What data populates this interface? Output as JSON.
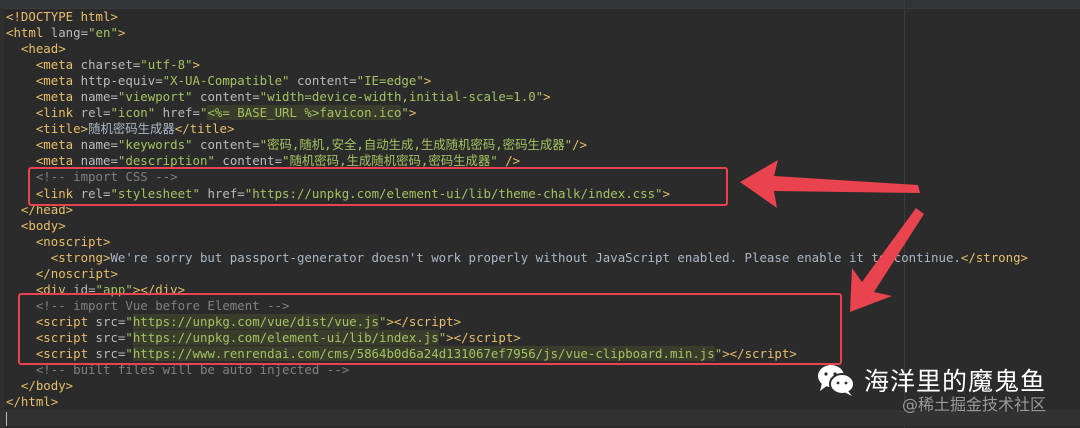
{
  "editor": {
    "lines": [
      [
        [
          "tag",
          "<!DOCTYPE html>"
        ]
      ],
      [
        [
          "tag",
          "<html "
        ],
        [
          "attr",
          "lang="
        ],
        [
          "val",
          "\"en\""
        ],
        [
          "tag",
          ">"
        ]
      ],
      [
        [
          "txt",
          "  "
        ],
        [
          "tag",
          "<head>"
        ]
      ],
      [
        [
          "txt",
          "    "
        ],
        [
          "tag",
          "<meta "
        ],
        [
          "attr",
          "charset="
        ],
        [
          "val",
          "\"utf-8\""
        ],
        [
          "tag",
          ">"
        ]
      ],
      [
        [
          "txt",
          "    "
        ],
        [
          "tag",
          "<meta "
        ],
        [
          "attr",
          "http-equiv="
        ],
        [
          "val",
          "\"X-UA-Compatible\""
        ],
        [
          "attr",
          " content="
        ],
        [
          "val",
          "\"IE=edge\""
        ],
        [
          "tag",
          ">"
        ]
      ],
      [
        [
          "txt",
          "    "
        ],
        [
          "tag",
          "<meta "
        ],
        [
          "attr",
          "name="
        ],
        [
          "val",
          "\"viewport\""
        ],
        [
          "attr",
          " content="
        ],
        [
          "val",
          "\"width=device-width,initial-scale=1.0\""
        ],
        [
          "tag",
          ">"
        ]
      ],
      [
        [
          "txt",
          "    "
        ],
        [
          "tag",
          "<link "
        ],
        [
          "attr",
          "rel="
        ],
        [
          "val",
          "\"icon\""
        ],
        [
          "attr",
          " href="
        ],
        [
          "val",
          "\""
        ],
        [
          "hl",
          "<%= BASE_URL %>favicon.ico"
        ],
        [
          "val",
          "\""
        ],
        [
          "tag",
          ">"
        ]
      ],
      [
        [
          "txt",
          "    "
        ],
        [
          "tag",
          "<title>"
        ],
        [
          "txt",
          "随机密码生成器"
        ],
        [
          "tag",
          "</title>"
        ]
      ],
      [
        [
          "txt",
          "    "
        ],
        [
          "tag",
          "<meta "
        ],
        [
          "attr",
          "name="
        ],
        [
          "val",
          "\"keywords\""
        ],
        [
          "attr",
          " content="
        ],
        [
          "val",
          "\"密码,随机,安全,自动生成,生成随机密码,密码生成器\""
        ],
        [
          "tag",
          "/>"
        ]
      ],
      [
        [
          "txt",
          "    "
        ],
        [
          "tag",
          "<meta "
        ],
        [
          "attr",
          "name="
        ],
        [
          "val",
          "\"description\""
        ],
        [
          "attr",
          " content="
        ],
        [
          "val",
          "\"随机密码,生成随机密码,密码生成器\""
        ],
        [
          "tag",
          " />"
        ]
      ],
      [
        [
          "txt",
          "    "
        ],
        [
          "cm",
          "<!-- import CSS -->"
        ]
      ],
      [
        [
          "txt",
          "    "
        ],
        [
          "tag",
          "<link "
        ],
        [
          "attr",
          "rel="
        ],
        [
          "val",
          "\"stylesheet\""
        ],
        [
          "attr",
          " href="
        ],
        [
          "val",
          "\"https://unpkg.com/element-ui/lib/theme-chalk/index.css\""
        ],
        [
          "tag",
          ">"
        ]
      ],
      [
        [
          "txt",
          "  "
        ],
        [
          "tag",
          "</head>"
        ]
      ],
      [
        [
          "txt",
          "  "
        ],
        [
          "tag",
          "<body>"
        ]
      ],
      [
        [
          "txt",
          "    "
        ],
        [
          "tag",
          "<noscript>"
        ]
      ],
      [
        [
          "txt",
          "      "
        ],
        [
          "tag",
          "<strong>"
        ],
        [
          "txt",
          "We're sorry but passport-generator doesn't work properly without JavaScript enabled. Please enable it to continue."
        ],
        [
          "tag",
          "</strong>"
        ]
      ],
      [
        [
          "txt",
          "    "
        ],
        [
          "tag",
          "</noscript>"
        ]
      ],
      [
        [
          "txt",
          "    "
        ],
        [
          "tag",
          "<div "
        ],
        [
          "attr",
          "id="
        ],
        [
          "val",
          "\"app\""
        ],
        [
          "tag",
          "></div>"
        ]
      ],
      [
        [
          "txt",
          "    "
        ],
        [
          "cm",
          "<!-- import Vue before Element -->"
        ]
      ],
      [
        [
          "txt",
          "    "
        ],
        [
          "tag",
          "<script "
        ],
        [
          "attr",
          "src="
        ],
        [
          "val",
          "\""
        ],
        [
          "hl",
          "https://unpkg.com/vue/dist/vue.js"
        ],
        [
          "val",
          "\""
        ],
        [
          "tag",
          "></script>"
        ]
      ],
      [
        [
          "txt",
          "    "
        ],
        [
          "tag",
          "<script "
        ],
        [
          "attr",
          "src="
        ],
        [
          "val",
          "\""
        ],
        [
          "hl",
          "https://unpkg.com/element-ui/lib/index.js"
        ],
        [
          "val",
          "\""
        ],
        [
          "tag",
          "></script>"
        ]
      ],
      [
        [
          "txt",
          "    "
        ],
        [
          "tag",
          "<script "
        ],
        [
          "attr",
          "src="
        ],
        [
          "val",
          "\""
        ],
        [
          "hl",
          "https://www.renrendai.com/cms/5864b0d6a24d131067ef7956/js/vue-clipboard.min.js"
        ],
        [
          "val",
          "\""
        ],
        [
          "tag",
          "></script>"
        ]
      ],
      [
        [
          "txt",
          "    "
        ],
        [
          "cm",
          "<!-- built files will be auto injected -->"
        ]
      ],
      [
        [
          "txt",
          "  "
        ],
        [
          "tag",
          "</body>"
        ]
      ],
      [
        [
          "tag",
          "</html>"
        ]
      ]
    ]
  },
  "watermark": {
    "icon": "wechat-icon",
    "name": "海洋里的魔鬼鱼",
    "source": "@稀土掘金技术社区"
  },
  "colors": {
    "annotation": "#e8434f",
    "background": "#2b2b2b"
  }
}
